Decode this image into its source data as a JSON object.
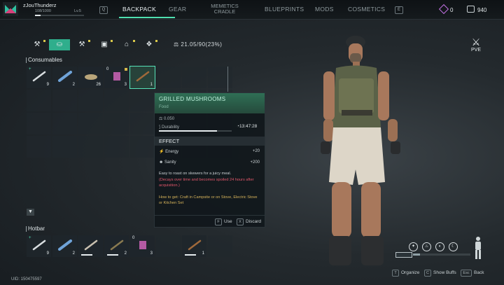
{
  "user": {
    "name": "zJouThunderz",
    "xp": "108/1000",
    "level": "Lv.5",
    "xp_fraction": 0.108
  },
  "nav": {
    "key_left": "Q",
    "key_right": "E",
    "tabs": [
      "BACKPACK",
      "GEAR",
      "MEMETICS CRADLE",
      "BLUEPRINTS",
      "MODS",
      "COSMETICS"
    ],
    "tab_cradle": "MEMETICS CRADLE",
    "active": "BACKPACK"
  },
  "currency": {
    "premium": "0",
    "credits": "940"
  },
  "categories": [
    {
      "icon": "wrench-icon",
      "glyph": "⚒",
      "flag": true
    },
    {
      "icon": "bag-icon",
      "glyph": "⛀",
      "active": true
    },
    {
      "icon": "tool-icon",
      "glyph": "⚒",
      "flag": true
    },
    {
      "icon": "crate-icon",
      "glyph": "▣",
      "flag": true
    },
    {
      "icon": "house-icon",
      "glyph": "⌂",
      "flag": true
    },
    {
      "icon": "wings-icon",
      "glyph": "❖",
      "flag": true
    }
  ],
  "weight": "21.05/90(23%)",
  "sections": {
    "consumables": "Consumables",
    "hotbar": "Hotbar"
  },
  "consumables": [
    {
      "name": "syringe",
      "count": "9",
      "plus": "+",
      "color": "#d9dee0"
    },
    {
      "name": "bandage",
      "count": "2",
      "color": "#6fa3d8"
    },
    {
      "name": "food-plate",
      "count": "26",
      "color": "#b9a57a"
    },
    {
      "name": "canned-food",
      "count": "3",
      "topleft": "0",
      "color": "#b35aa3",
      "gem": true
    },
    {
      "name": "grilled-mushrooms",
      "count": "1",
      "color": "#a0693a",
      "selected": true
    }
  ],
  "hotbar": [
    {
      "name": "syringe",
      "count": "9",
      "plus": "+",
      "color": "#d9dee0"
    },
    {
      "name": "bandage",
      "count": "2",
      "color": "#6fa3d8"
    },
    {
      "name": "pickaxe",
      "count": "",
      "color": "#c9c0b0",
      "bar": true
    },
    {
      "name": "baton",
      "count": "2",
      "color": "#8a7a50",
      "bar": true
    },
    {
      "name": "canned-food",
      "count": "3",
      "topleft": "0",
      "color": "#b35aa3"
    },
    {
      "name": "empty",
      "count": ""
    },
    {
      "name": "grilled-mushrooms",
      "count": "1",
      "color": "#a0693a",
      "bar": true
    },
    {
      "name": "empty",
      "count": ""
    }
  ],
  "tooltip": {
    "title": "GRILLED MUSHROOMS",
    "type": "Food",
    "weight": "0.050",
    "durability_label": "Durability",
    "durability_fraction": 0.8,
    "timer": "13:47:28",
    "effect_header": "EFFECT",
    "effects": [
      {
        "label": "Energy",
        "value": "+20"
      },
      {
        "label": "Sanity",
        "value": "+200"
      }
    ],
    "description": "Easy to roast on skewers for a juicy meal.",
    "warning": "(Decays over time and becomes spoiled 24 hours after acquisition.)",
    "how_to_get": "How to get: Craft in Campsite or on Stove, Electric Stove or Kitchen Set",
    "use_key": "F",
    "use_label": "Use",
    "discard_key": "X",
    "discard_label": "Discard"
  },
  "mode": "PVE",
  "bottom": {
    "organize_key": "T",
    "organize": "Organize",
    "buffs_key": "C",
    "buffs": "Show Buffs",
    "back_key": "Esc",
    "back": "Back",
    "uid": "UID: 150475597"
  }
}
